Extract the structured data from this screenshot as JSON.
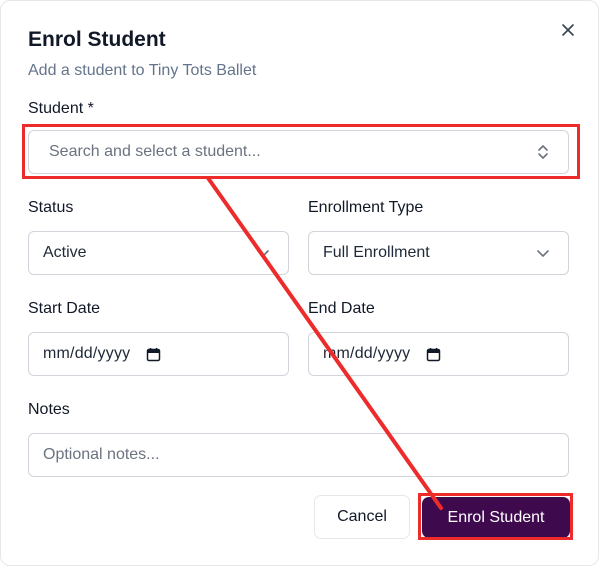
{
  "dialog": {
    "title": "Enrol Student",
    "subtitle": "Add a student to Tiny Tots Ballet",
    "close_icon": "close-icon"
  },
  "form": {
    "student": {
      "label": "Student *",
      "placeholder": "Search and select a student..."
    },
    "status": {
      "label": "Status",
      "value": "Active"
    },
    "enrollment_type": {
      "label": "Enrollment Type",
      "value": "Full Enrollment"
    },
    "start_date": {
      "label": "Start Date",
      "value": "mm/dd/yyyy"
    },
    "end_date": {
      "label": "End Date",
      "value": "mm/dd/yyyy"
    },
    "notes": {
      "label": "Notes",
      "placeholder": "Optional notes..."
    }
  },
  "actions": {
    "cancel_label": "Cancel",
    "submit_label": "Enrol Student"
  },
  "annotation": {
    "color": "#ee2b2b",
    "primary_button_color": "#3f0a4d"
  }
}
